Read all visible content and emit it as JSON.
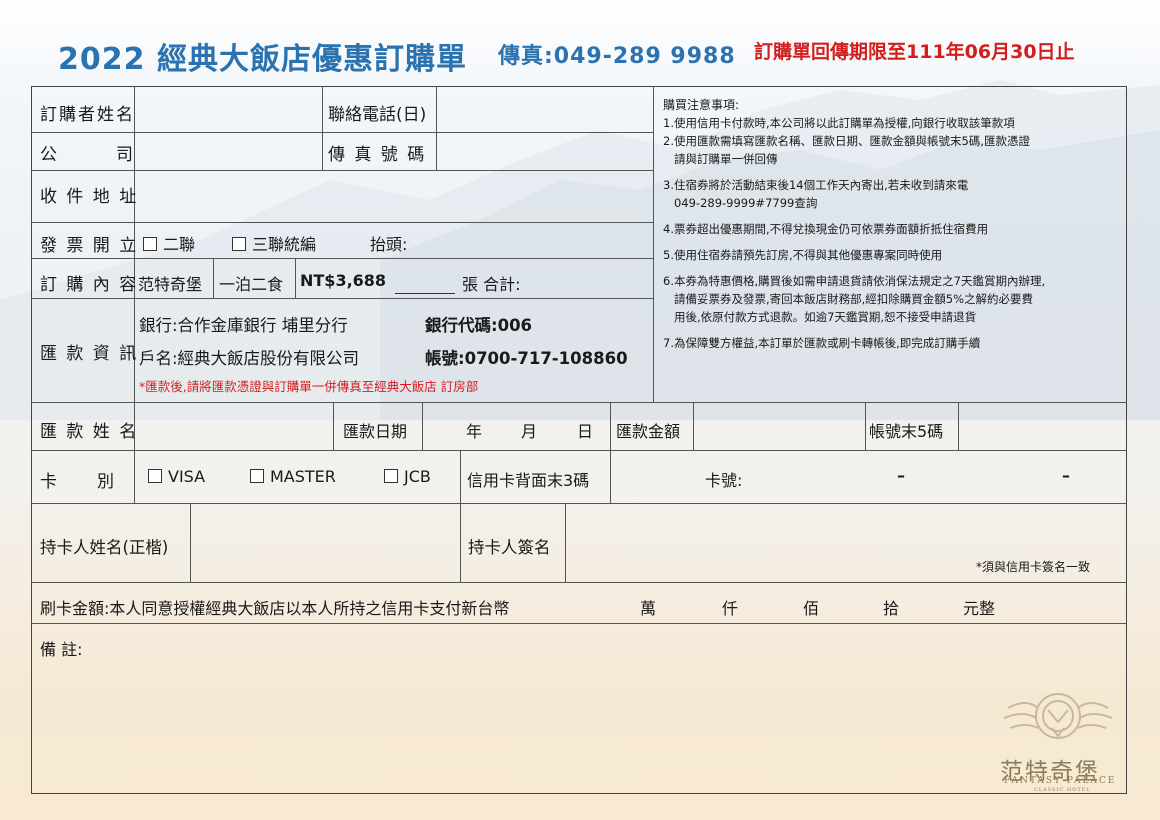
{
  "header": {
    "title": "2022 經典大飯店優惠訂購單",
    "fax": "傳真:049-289 9988",
    "deadline": "訂購單回傳期限至111年06月30日止"
  },
  "form": {
    "orderer_name": "訂購者姓名",
    "phone": "聯絡電話(日)",
    "company": "公　　　司",
    "fax_number": "傳 真 號 碼",
    "address": "收 件 地 址",
    "invoice": "發 票 開 立",
    "invoice_opt1": "二聯",
    "invoice_opt2": "三聯統編",
    "invoice_title": "抬頭:",
    "order_content": "訂 購 內 容",
    "product": "范特奇堡",
    "plan": "一泊二食",
    "price": "NT$3,688",
    "qty_total": "張  合計:",
    "remit_info": "匯 款 資 訊",
    "bank": "銀行:合作金庫銀行 埔里分行",
    "bank_code": "銀行代碼:006",
    "account_name": "戶名:經典大飯店股份有限公司",
    "account_no": "帳號:0700-717-108860",
    "remit_note": "*匯款後,請將匯款憑證與訂購單一併傳真至經典大飯店 訂房部",
    "remitter": "匯 款 姓 名",
    "remit_date": "匯款日期",
    "year": "年",
    "month": "月",
    "day": "日",
    "remit_amount": "匯款金額",
    "account_last5": "帳號末5碼",
    "card_type": "卡　　別",
    "visa": "VISA",
    "master": "MASTER",
    "jcb": "JCB",
    "cvv": "信用卡背面末3碼",
    "card_no": "卡號:",
    "dash1": "–",
    "dash2": "–",
    "holder": "持卡人姓名(正楷)",
    "signature": "持卡人簽名",
    "signature_note": "*須與信用卡簽名一致",
    "charge": "刷卡金額:本人同意授權經典大飯店以本人所持之信用卡支付新台幣",
    "u_wan": "萬",
    "u_qian": "仟",
    "u_bai": "佰",
    "u_shi": "拾",
    "u_yuan": "元整",
    "remarks": "備 註:"
  },
  "notices": {
    "title": "購買注意事項:",
    "items": [
      "1.使用信用卡付款時,本公司將以此訂購單為授權,向銀行收取該筆款項",
      "2.使用匯款需填寫匯款名稱、匯款日期、匯款金額與帳號末5碼,匯款憑證\n   請與訂購單一併回傳",
      "3.住宿券將於活動結束後14個工作天內寄出,若未收到請來電\n   049-289-9999#7799查詢",
      "4.票券超出優惠期間,不得兌換現金仍可依票券面額折抵住宿費用",
      "5.使用住宿券請預先訂房,不得與其他優惠專案同時使用",
      "6.本券為特惠價格,購買後如需申請退貨請依消保法規定之7天鑑賞期內辦理,\n   請備妥票券及發票,寄回本飯店財務部,經扣除購買金額5%之解約必要費\n   用後,依原付款方式退款。如逾7天鑑賞期,恕不接受申請退貨",
      "7.為保障雙方權益,本訂單於匯款或刷卡轉帳後,即完成訂購手續"
    ]
  },
  "logo": {
    "name": "范特奇堡",
    "en": "FANTASY PALACE",
    "sub": "CLASSIC HOTEL"
  },
  "colors": {
    "title_blue": "#2a73b0",
    "accent_red": "#d41e1e",
    "logo_gold": "#8a7d5a"
  }
}
